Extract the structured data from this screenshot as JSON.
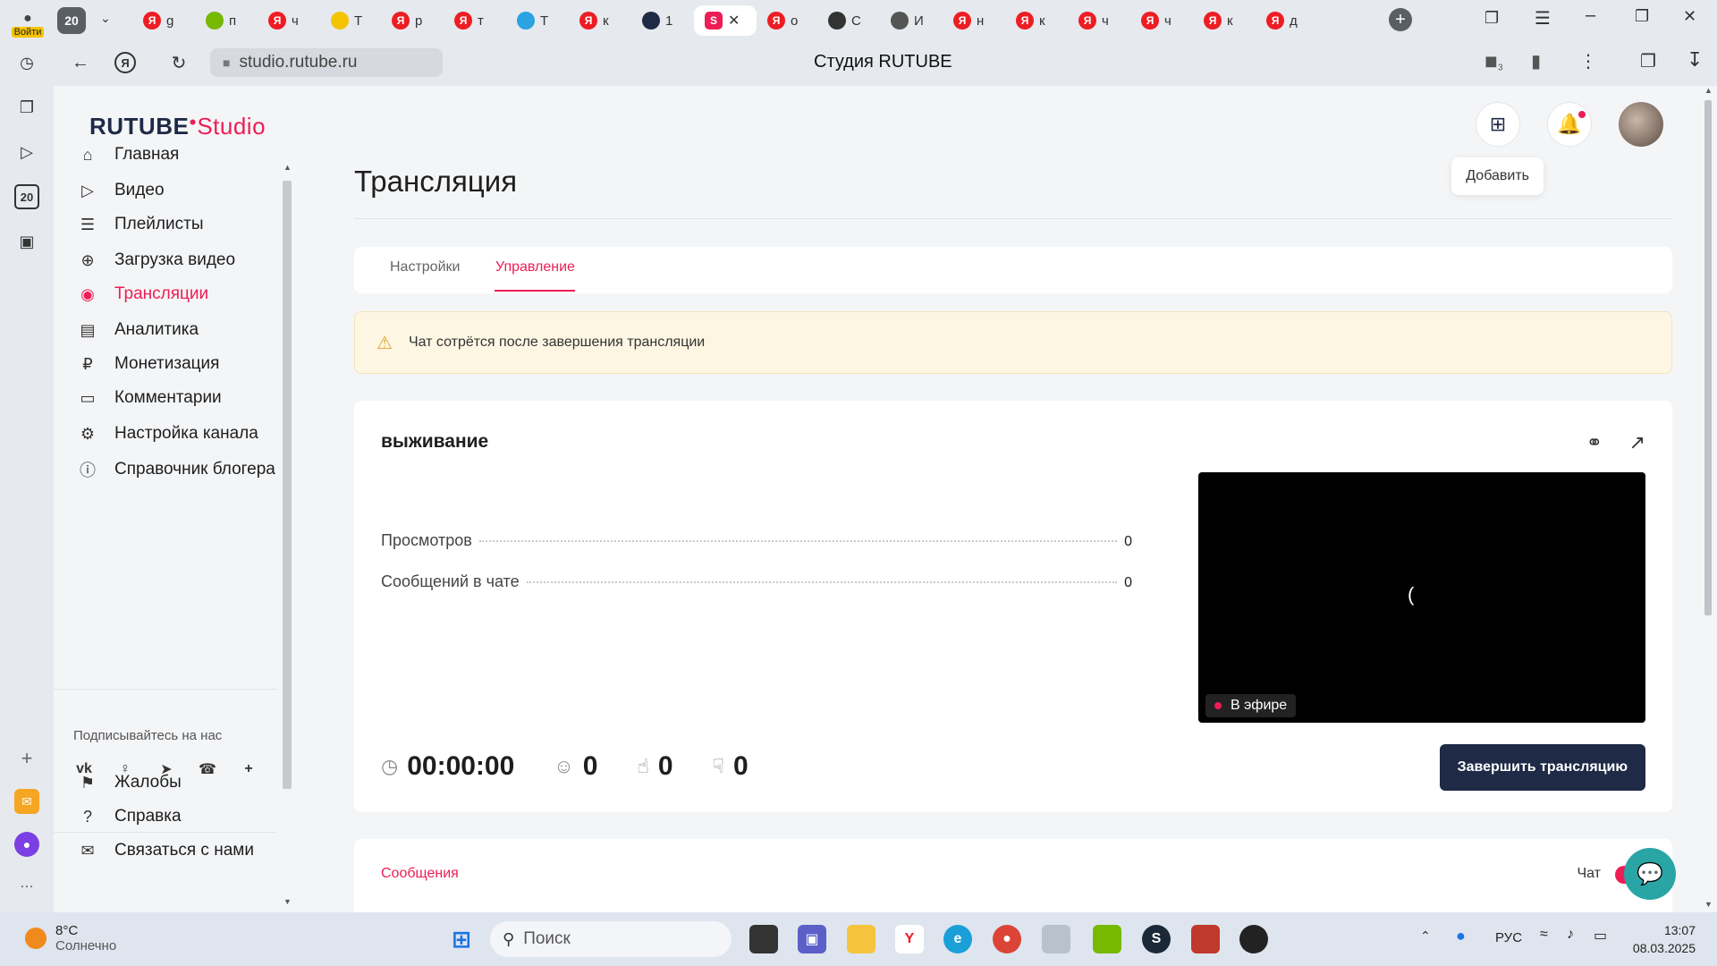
{
  "browser": {
    "tabs": [
      {
        "label": "g",
        "icon": "yandex-icon",
        "color": "#ed1d24"
      },
      {
        "label": "п",
        "icon": "nvidia-icon",
        "color": "#76b900"
      },
      {
        "label": "ч",
        "icon": "yandex-icon",
        "color": "#ed1d24"
      },
      {
        "label": "T",
        "icon": "play-icon",
        "color": "#f5c400"
      },
      {
        "label": "р",
        "icon": "yandex-icon",
        "color": "#ed1d24"
      },
      {
        "label": "т",
        "icon": "yandex-icon",
        "color": "#ed1d24"
      },
      {
        "label": "T",
        "icon": "telegram-icon",
        "color": "#2aa3e0"
      },
      {
        "label": "к",
        "icon": "yandex-icon",
        "color": "#ed1d24"
      },
      {
        "label": "1",
        "icon": "rutube-icon",
        "color": "#1e2a46"
      }
    ],
    "tabs_right": [
      {
        "label": "о",
        "icon": "yandex-icon",
        "color": "#ed1d24"
      },
      {
        "label": "С",
        "icon": "steam-icon",
        "color": "#333333"
      },
      {
        "label": "И",
        "icon": "document-icon",
        "color": "#555555"
      },
      {
        "label": "н",
        "icon": "yandex-icon",
        "color": "#ed1d24"
      },
      {
        "label": "к",
        "icon": "yandex-icon",
        "color": "#ed1d24"
      },
      {
        "label": "ч",
        "icon": "yandex-icon",
        "color": "#ed1d24"
      },
      {
        "label": "ч",
        "icon": "yandex-icon",
        "color": "#ed1d24"
      },
      {
        "label": "к",
        "icon": "yandex-icon",
        "color": "#ed1d24"
      },
      {
        "label": "д",
        "icon": "yandex-icon",
        "color": "#ed1d24"
      }
    ],
    "tab_count_badge": "20",
    "login_label": "Войти",
    "url": "studio.rutube.ru",
    "window_title": "Студия RUTUBE",
    "shield_count": "3",
    "strip_badge": "20"
  },
  "app": {
    "logo_main": "RUTUBE",
    "logo_sub": "Studio",
    "tooltip": "Добавить",
    "sidebar": {
      "items": [
        {
          "label": "Главная",
          "icon": "home-icon"
        },
        {
          "label": "Видео",
          "icon": "video-icon"
        },
        {
          "label": "Плейлисты",
          "icon": "playlist-icon"
        },
        {
          "label": "Загрузка видео",
          "icon": "upload-icon"
        },
        {
          "label": "Трансляции",
          "icon": "broadcast-icon",
          "active": true
        },
        {
          "label": "Аналитика",
          "icon": "analytics-icon"
        },
        {
          "label": "Монетизация",
          "icon": "ruble-icon"
        },
        {
          "label": "Комментарии",
          "icon": "comment-icon"
        },
        {
          "label": "Настройка канала",
          "icon": "gear-icon"
        },
        {
          "label": "Справочник блогера",
          "icon": "info-icon"
        }
      ],
      "follow_label": "Подписывайтесь на нас",
      "socials": [
        "vk-icon",
        "ok-icon",
        "telegram-icon",
        "viber-icon",
        "plus-icon"
      ],
      "bottom_items": [
        {
          "label": "Жалобы",
          "icon": "flag-icon"
        },
        {
          "label": "Справка",
          "icon": "help-icon"
        },
        {
          "label": "Связаться с нами",
          "icon": "mail-icon"
        }
      ]
    },
    "page_title": "Трансляция",
    "tabs": [
      {
        "label": "Настройки",
        "active": false
      },
      {
        "label": "Управление",
        "active": true
      }
    ],
    "warning": "Чат сотрётся после завершения трансляции",
    "stream": {
      "name": "выживание",
      "stats": [
        {
          "label": "Просмотров",
          "value": "0"
        },
        {
          "label": "Сообщений в чате",
          "value": "0"
        }
      ],
      "live_label": "В эфире",
      "timer": "00:00:00",
      "viewers": "0",
      "likes": "0",
      "dislikes": "0",
      "end_button": "Завершить трансляцию"
    },
    "messages_label": "Сообщения",
    "chat_label": "Чат",
    "chat_enabled": true,
    "accent_color": "#ed1d55",
    "dark_color": "#1e2a46"
  },
  "taskbar": {
    "weather_temp": "8°C",
    "weather_desc": "Солнечно",
    "search_placeholder": "Поиск",
    "lang": "РУС",
    "time": "13:07",
    "date": "08.03.2025"
  }
}
